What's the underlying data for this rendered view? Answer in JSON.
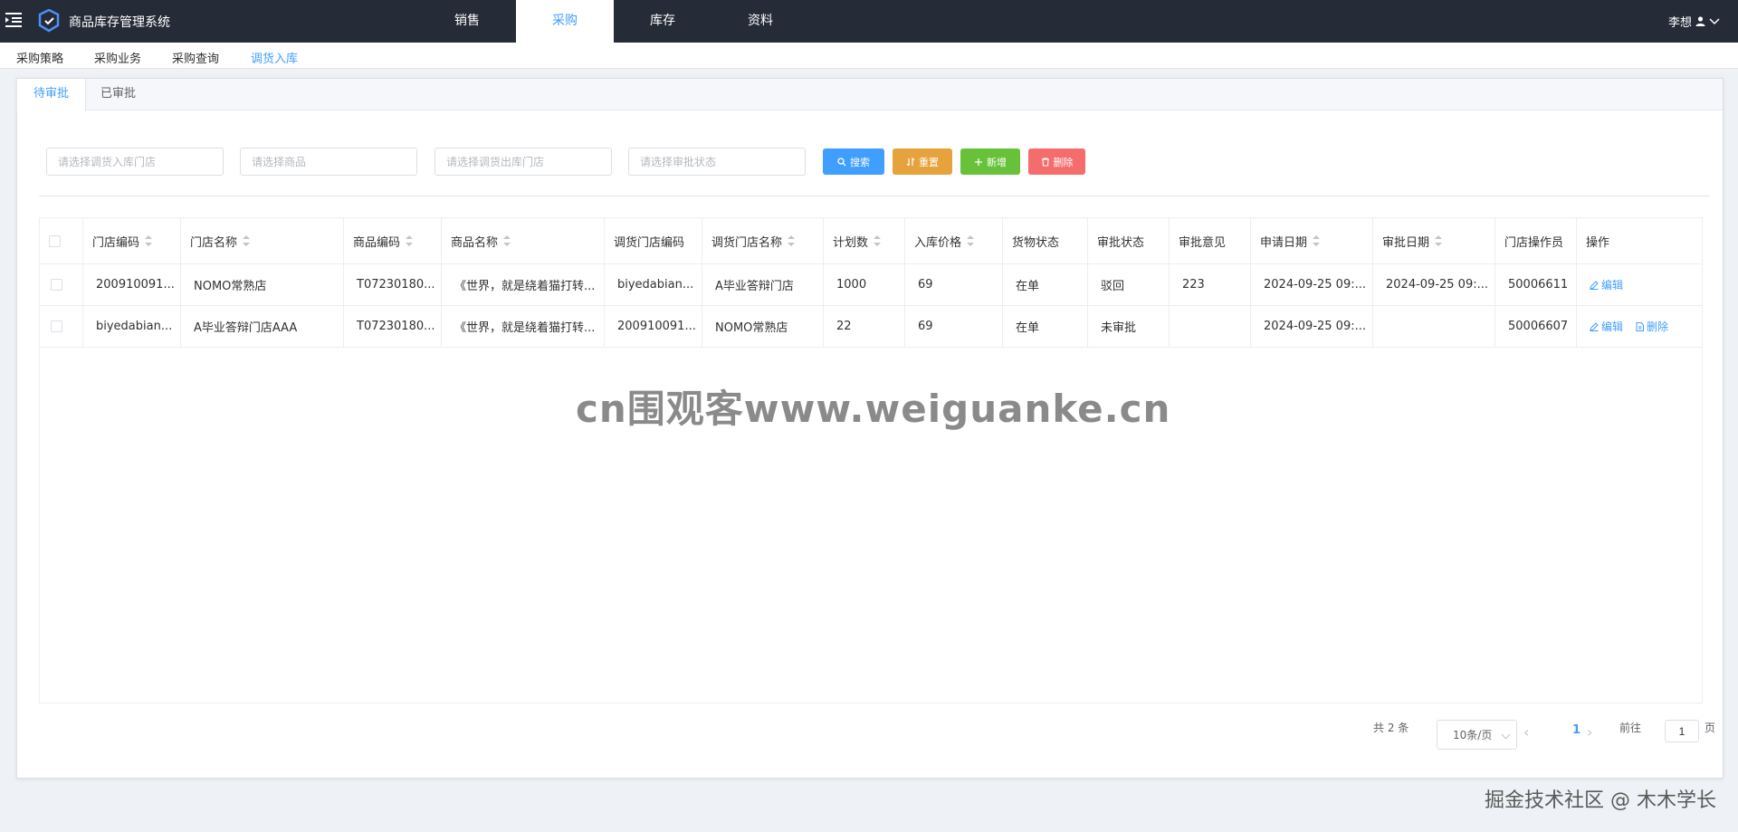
{
  "app": {
    "title": "商品库存管理系统",
    "user": "李想"
  },
  "nav": [
    "销售",
    "采购",
    "库存",
    "资料"
  ],
  "nav_active": "采购",
  "subnav": [
    "采购策略",
    "采购业务",
    "采购查询",
    "调货入库"
  ],
  "subnav_active": "调货入库",
  "tabs": [
    "待审批",
    "已审批"
  ],
  "filters": {
    "in_store": "请选择调货入库门店",
    "product": "请选择商品",
    "out_store": "请选择调货出库门店",
    "status": "请选择审批状态"
  },
  "buttons": {
    "search": "搜索",
    "reset": "重置",
    "add": "新增",
    "delete": "删除"
  },
  "colors": {
    "primary": "#409eff",
    "warning": "#e6a23c",
    "success": "#67c23a",
    "danger": "#f56c6c",
    "header": "#252b37"
  },
  "table": {
    "headers": [
      "门店编码",
      "门店名称",
      "商品编码",
      "商品名称",
      "调货门店编码",
      "调货门店名称",
      "计划数",
      "入库价格",
      "货物状态",
      "审批状态",
      "审批意见",
      "申请日期",
      "审批日期",
      "门店操作员",
      "操作"
    ],
    "rows": [
      [
        "200910091...",
        "NOMO常熟店",
        "T07230180...",
        "《世界，就是绕着猫打转...",
        "biyedabian...",
        "A毕业答辩门店",
        "1000",
        "69",
        "在单",
        "驳回",
        "223",
        "2024-09-25 09:...",
        "2024-09-25 09:...",
        "50006611"
      ],
      [
        "biyedabian...",
        "A毕业答辩门店AAA",
        "T07230180...",
        "《世界，就是绕着猫打转...",
        "200910091...",
        "NOMO常熟店",
        "22",
        "69",
        "在单",
        "未审批",
        "",
        "2024-09-25 09:...",
        "",
        "50006607"
      ]
    ],
    "ops": {
      "edit": "编辑",
      "delete": "删除"
    }
  },
  "pagination": {
    "total": "共 2 条",
    "page_size": "10条/页",
    "current_page": "1",
    "goto": "前往",
    "goto_value": "1",
    "page_unit": "页"
  },
  "watermark": "cn围观客www.weiguanke.cn",
  "credit": "掘金技术社区 @ 木木学长"
}
